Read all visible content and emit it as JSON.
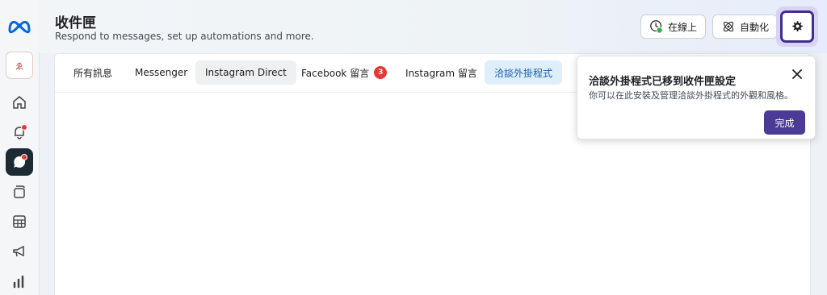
{
  "header": {
    "title": "收件匣",
    "subtitle": "Respond to messages, set up automations and more.",
    "online_label": "在線上",
    "automation_label": "自動化"
  },
  "tabs": [
    {
      "label": "所有訊息"
    },
    {
      "label": "Messenger"
    },
    {
      "label": "Instagram Direct"
    },
    {
      "label": "Facebook 留言",
      "badge": "3"
    },
    {
      "label": "Instagram 留言"
    },
    {
      "label": "洽談外掛程式"
    }
  ],
  "popover": {
    "title": "洽談外掛程式已移到收件匣設定",
    "body": "你可以在此安裝及管理洽談外掛程式的外觀和風格。",
    "done_label": "完成"
  },
  "rail": {
    "avatar_text": "ゑ"
  },
  "colors": {
    "accent": "#4b3a96",
    "online_dot": "#2fb344",
    "badge": "#e53935",
    "selected_tab": "#deeefb"
  },
  "icons": [
    "meta-logo-icon",
    "home-icon",
    "bell-icon",
    "chat-icon",
    "layers-icon",
    "table-icon",
    "megaphone-icon",
    "bar-chart-icon",
    "clock-icon",
    "automation-icon",
    "gear-icon",
    "close-icon"
  ]
}
